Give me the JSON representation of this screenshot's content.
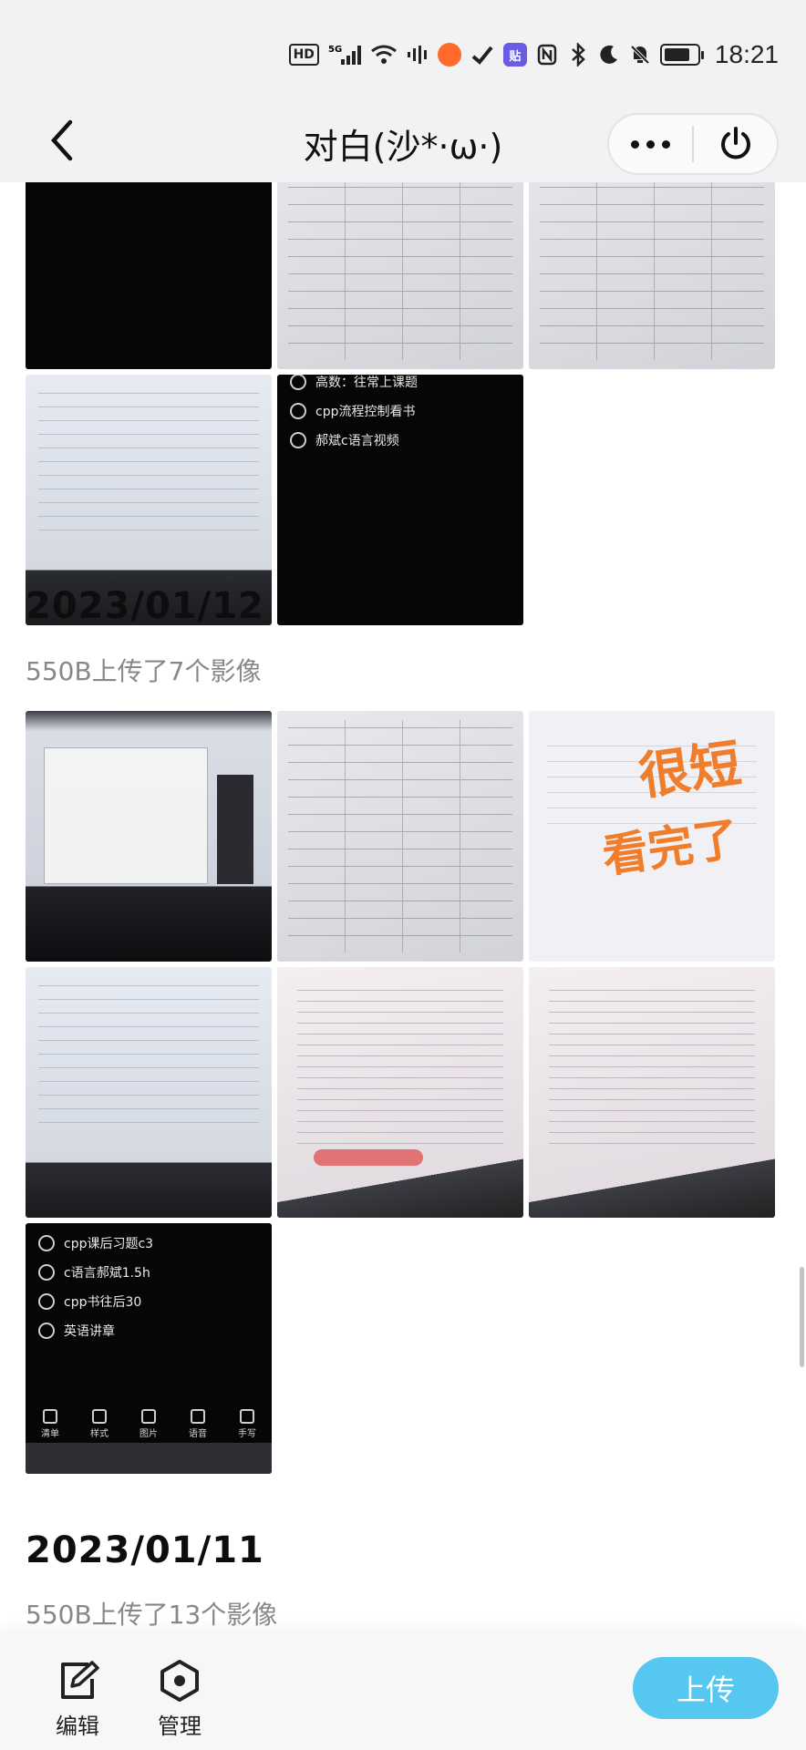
{
  "status_bar": {
    "network": "HD",
    "signal": "5G",
    "app_badge": "贴",
    "time": "18:21",
    "battery_level": 0.8
  },
  "nav": {
    "title": "对白(沙*·ω·)"
  },
  "top_partial": {
    "todo_items": [
      "高数：往常上课题",
      "cpp流程控制看书",
      "郝斌c语言视频"
    ]
  },
  "sections": [
    {
      "date": "2023/01/12",
      "summary": "550B上传了7个影像",
      "scribble_text_1": "很短",
      "scribble_text_2": "看完了",
      "todo_items": [
        "cpp课后习题c3",
        "c语言郝斌1.5h",
        "cpp书往后30",
        "英语讲章"
      ],
      "toolbar_labels": [
        "清单",
        "样式",
        "图片",
        "语音",
        "手写"
      ]
    },
    {
      "date": "2023/01/11",
      "summary": "550B上传了13个影像"
    }
  ],
  "bottom_bar": {
    "edit_label": "编辑",
    "manage_label": "管理",
    "upload_label": "上传",
    "accent_color": "#55c7f0"
  }
}
